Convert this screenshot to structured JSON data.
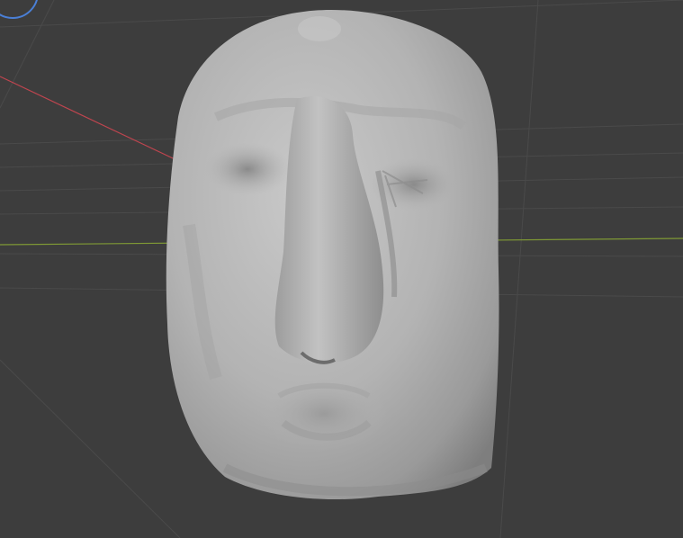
{
  "viewport": {
    "view": "perspective",
    "background_color": "#3d3d3d",
    "grid_color": "#4a4a4a",
    "x_axis_color": "#c0454f",
    "y_axis_color": "#7f9935",
    "mesh_color": "#b8b8b8",
    "gizmo_color": "#4a7fd6"
  },
  "mesh": {
    "object": "sculpted face"
  },
  "icons": {
    "navigation_gizmo": "navigation-gizmo-icon"
  }
}
